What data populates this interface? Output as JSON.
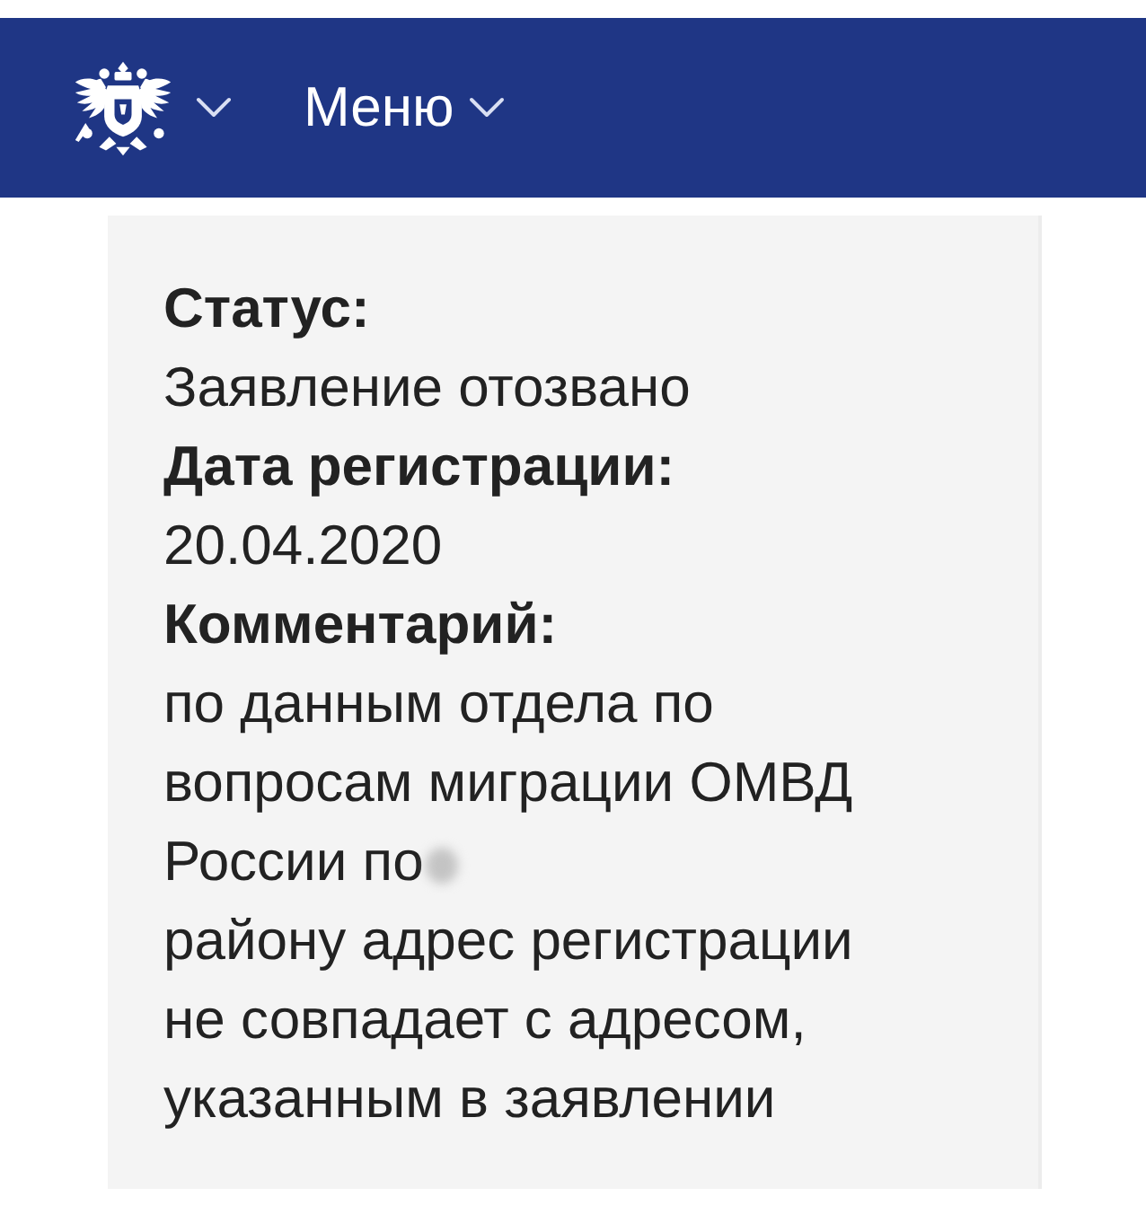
{
  "header": {
    "menu_label": "Меню"
  },
  "details": [
    {
      "label": "Статус:",
      "value": "Заявление отозвано"
    },
    {
      "label": "Дата регистрации:",
      "value": "20.04.2020"
    }
  ],
  "comment": {
    "label": "Комментарий:",
    "text_start": "по данным отдела по вопросам миграции ОМВД России по",
    "redacted": true,
    "text_end": "району адрес регистрации не совпадает с адресом, указанным в заявлении"
  }
}
